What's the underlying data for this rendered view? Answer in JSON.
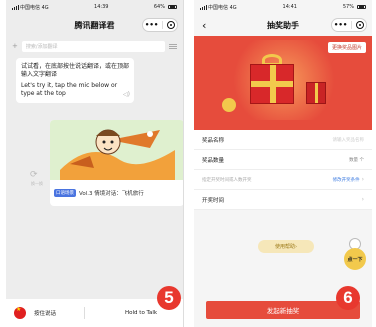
{
  "left_phone": {
    "status": {
      "carrier": "中国电信 4G",
      "time": "14:39",
      "battery": "64%"
    },
    "title": "腾讯翻译君",
    "capsule": {
      "more": "•••"
    },
    "search": {
      "plus": "+",
      "placeholder": "搜索/添加翻译"
    },
    "bubble": {
      "cn": "试试看，在底部按住说话翻译，或在顶部输入文字翻译",
      "en": "Let's try it, tap the mic below or type at the top"
    },
    "card": {
      "tag": "口语场景",
      "caption": "Vol.3 情境对话：飞机旅行"
    },
    "refresh_label": "换一换",
    "bottom": {
      "cn_label": "按住说话",
      "en_label": "Hold to Talk"
    },
    "badge": "5"
  },
  "right_phone": {
    "status": {
      "carrier": "中国电信 4G",
      "time": "14:41",
      "battery": "57%"
    },
    "title": "抽奖助手",
    "capsule": {
      "more": "•••"
    },
    "hero_button": "更换奖品图片",
    "form": [
      {
        "label": "奖品名称",
        "value": "请输入奖品名称",
        "style": "placeholder"
      },
      {
        "label": "奖品数量",
        "value": "数量 个",
        "style": "value"
      },
      {
        "label": "指定开奖时间或人数开奖",
        "value": "修改开奖条件",
        "style": "link"
      },
      {
        "label": "开奖时间",
        "value": "",
        "style": "chevron"
      }
    ],
    "help_button": "使用帮助",
    "mascot_label": "点一下",
    "submit": "发起新抽奖",
    "badge": "6"
  },
  "colors": {
    "accent_red": "#e64c3c",
    "badge_red": "#e8382e",
    "link_blue": "#3c7be0"
  }
}
